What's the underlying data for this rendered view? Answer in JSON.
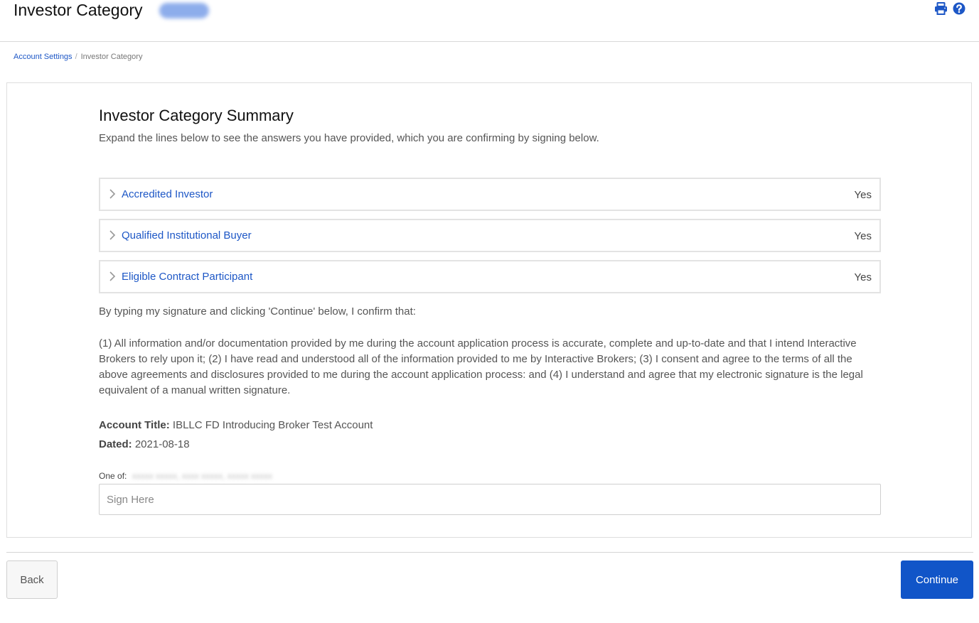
{
  "header": {
    "title": "Investor Category",
    "icons": [
      "print-icon",
      "help-icon"
    ],
    "accent_color": "#1d57c6"
  },
  "breadcrumb": {
    "items": [
      "Account Settings",
      "Investor Category"
    ],
    "separator": "/"
  },
  "summary": {
    "title": "Investor Category Summary",
    "subtitle": "Expand the lines below to see the answers you have provided, which you are confirming by signing below."
  },
  "categories": [
    {
      "label": "Accredited Investor",
      "value": "Yes"
    },
    {
      "label": "Qualified Institutional Buyer",
      "value": "Yes"
    },
    {
      "label": "Eligible Contract Participant",
      "value": "Yes"
    }
  ],
  "confirmation": {
    "intro": "By typing my signature and clicking 'Continue' below, I confirm that:",
    "body": "(1) All information and/or documentation provided by me during the account application process is accurate, complete and up-to-date and that I intend Interactive Brokers to rely upon it; (2) I have read and understood all of the information provided to me by Interactive Brokers; (3) I consent and agree to the terms of all the above agreements and disclosures provided to me during the account application process: and (4) I understand and agree that my electronic signature is the legal equivalent of a manual written signature."
  },
  "account": {
    "title_label": "Account Title:",
    "title_value": "IBLLC FD Introducing Broker Test Account",
    "dated_label": "Dated:",
    "dated_value": "2021-08-18"
  },
  "signature": {
    "one_of_label": "One of:",
    "placeholder": "Sign Here",
    "value": ""
  },
  "footer": {
    "back_label": "Back",
    "continue_label": "Continue",
    "continue_color": "#1155c8"
  }
}
